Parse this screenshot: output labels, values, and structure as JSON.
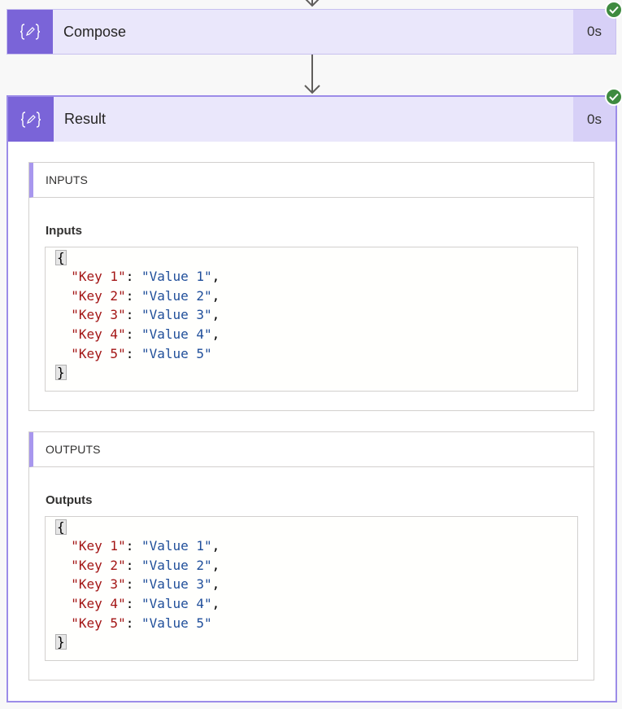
{
  "compose_action": {
    "title": "Compose",
    "duration": "0s",
    "icon": "curly-braces-pencil-icon",
    "status": "succeeded"
  },
  "result_action": {
    "title": "Result",
    "duration": "0s",
    "icon": "curly-braces-pencil-icon",
    "status": "succeeded",
    "inputs_section": {
      "header": "INPUTS",
      "field_label": "Inputs",
      "open_brace": "{",
      "close_brace": "}",
      "entries": [
        {
          "key": "\"Key 1\"",
          "value": "\"Value 1\"",
          "sep": ","
        },
        {
          "key": "\"Key 2\"",
          "value": "\"Value 2\"",
          "sep": ","
        },
        {
          "key": "\"Key 3\"",
          "value": "\"Value 3\"",
          "sep": ","
        },
        {
          "key": "\"Key 4\"",
          "value": "\"Value 4\"",
          "sep": ","
        },
        {
          "key": "\"Key 5\"",
          "value": "\"Value 5\"",
          "sep": ""
        }
      ]
    },
    "outputs_section": {
      "header": "OUTPUTS",
      "field_label": "Outputs",
      "open_brace": "{",
      "close_brace": "}",
      "entries": [
        {
          "key": "\"Key 1\"",
          "value": "\"Value 1\"",
          "sep": ","
        },
        {
          "key": "\"Key 2\"",
          "value": "\"Value 2\"",
          "sep": ","
        },
        {
          "key": "\"Key 3\"",
          "value": "\"Value 3\"",
          "sep": ","
        },
        {
          "key": "\"Key 4\"",
          "value": "\"Value 4\"",
          "sep": ","
        },
        {
          "key": "\"Key 5\"",
          "value": "\"Value 5\"",
          "sep": ""
        }
      ]
    }
  },
  "colors": {
    "accent": "#7a64d8",
    "header_bg": "#eae7fb",
    "duration_bg": "#d7d0f7",
    "success": "#3e8a3f",
    "json_key": "#a31515",
    "json_value": "#1f4e9a"
  }
}
